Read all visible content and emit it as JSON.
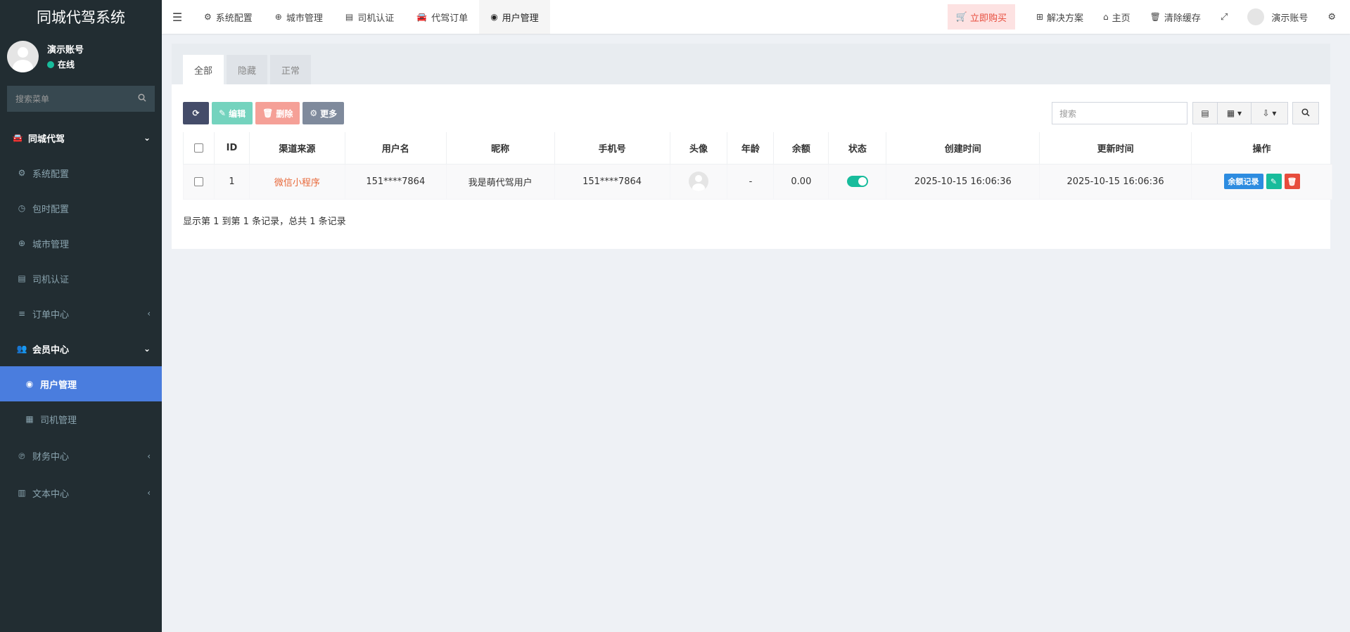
{
  "sidebar": {
    "brand": "同城代驾系统",
    "user_name": "演示账号",
    "user_status": "在线",
    "search_placeholder": "搜索菜单",
    "items": [
      {
        "label": "同城代驾",
        "icon": "car-icon",
        "arrow": "⌄"
      },
      {
        "label": "系统配置",
        "icon": "gear-icon"
      },
      {
        "label": "包时配置",
        "icon": "clock-icon"
      },
      {
        "label": "城市管理",
        "icon": "plus-circle-icon"
      },
      {
        "label": "司机认证",
        "icon": "id-card-icon"
      },
      {
        "label": "订单中心",
        "icon": "list-icon",
        "arrow": "‹"
      },
      {
        "label": "会员中心",
        "icon": "users-icon",
        "arrow": "⌄"
      },
      {
        "label": "用户管理",
        "icon": "user-circle-icon"
      },
      {
        "label": "司机管理",
        "icon": "card-icon"
      },
      {
        "label": "财务中心",
        "icon": "paypal-icon",
        "arrow": "‹"
      },
      {
        "label": "文本中心",
        "icon": "file-icon",
        "arrow": "‹"
      }
    ]
  },
  "navbar": {
    "tabs": [
      {
        "label": "系统配置",
        "icon": "gear-icon"
      },
      {
        "label": "城市管理",
        "icon": "plus-circle-icon"
      },
      {
        "label": "司机认证",
        "icon": "id-card-icon"
      },
      {
        "label": "代驾订单",
        "icon": "car-icon"
      },
      {
        "label": "用户管理",
        "icon": "user-circle-icon"
      }
    ],
    "buy_now": "立即购买",
    "solutions": "解决方案",
    "home": "主页",
    "clear_cache": "清除缓存",
    "account": "演示账号"
  },
  "content": {
    "filter_tabs": [
      "全部",
      "隐藏",
      "正常"
    ],
    "toolbar": {
      "edit": "编辑",
      "delete": "删除",
      "more": "更多"
    },
    "search_placeholder": "搜索",
    "columns": [
      "ID",
      "渠道来源",
      "用户名",
      "昵称",
      "手机号",
      "头像",
      "年龄",
      "余额",
      "状态",
      "创建时间",
      "更新时间",
      "操作"
    ],
    "rows": [
      {
        "id": "1",
        "channel": "微信小程序",
        "username": "151****7864",
        "nickname": "我是萌代驾用户",
        "phone": "151****7864",
        "age": "-",
        "balance": "0.00",
        "status_on": true,
        "created": "2025-10-15 16:06:36",
        "updated": "2025-10-15 16:06:36",
        "op_balance": "余额记录"
      }
    ],
    "pager_text": "显示第 1 到第 1 条记录，总共 1 条记录"
  },
  "colors": {
    "sidebar_bg": "#222d32",
    "active_menu": "#4a7dde",
    "success": "#18bc9c",
    "danger": "#e74c3c",
    "channel_text": "#e8693b"
  }
}
